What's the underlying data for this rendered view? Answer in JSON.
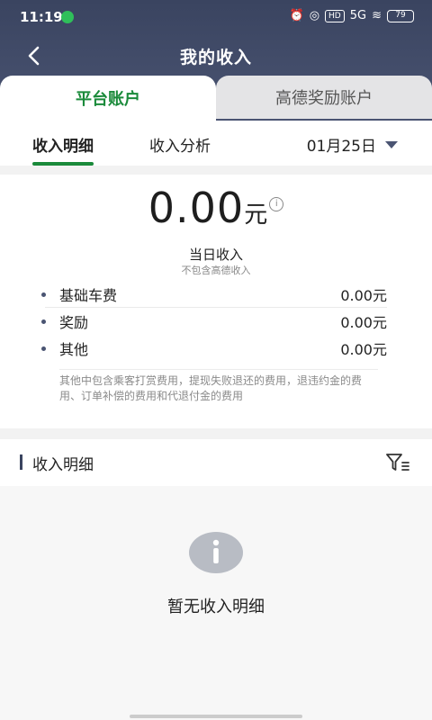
{
  "status_bar": {
    "time": "11:19",
    "signal_text": "5G",
    "hd_badge": "HD",
    "battery": "79"
  },
  "nav": {
    "title": "我的收入"
  },
  "account_tabs": [
    {
      "label": "平台账户",
      "active": true
    },
    {
      "label": "高德奖励账户",
      "active": false
    }
  ],
  "sub_tabs": [
    {
      "label": "收入明细",
      "active": true
    },
    {
      "label": "收入分析",
      "active": false
    }
  ],
  "date_picker": {
    "value": "01月25日"
  },
  "summary": {
    "amount": "0.00",
    "unit": "元",
    "label": "当日收入",
    "sublabel": "不包含高德收入",
    "rows": [
      {
        "label": "基础车费",
        "value": "0.00元"
      },
      {
        "label": "奖励",
        "value": "0.00元"
      },
      {
        "label": "其他",
        "value": "0.00元"
      }
    ],
    "note": "其他中包含乘客打赏费用，提现失败退还的费用，退违约金的费用、订单补偿的费用和代退付金的费用"
  },
  "detail": {
    "title": "收入明细"
  },
  "empty_state": {
    "text": "暂无收入明细"
  },
  "colors": {
    "accent": "#1a8a3a",
    "header": "#3a4460"
  }
}
